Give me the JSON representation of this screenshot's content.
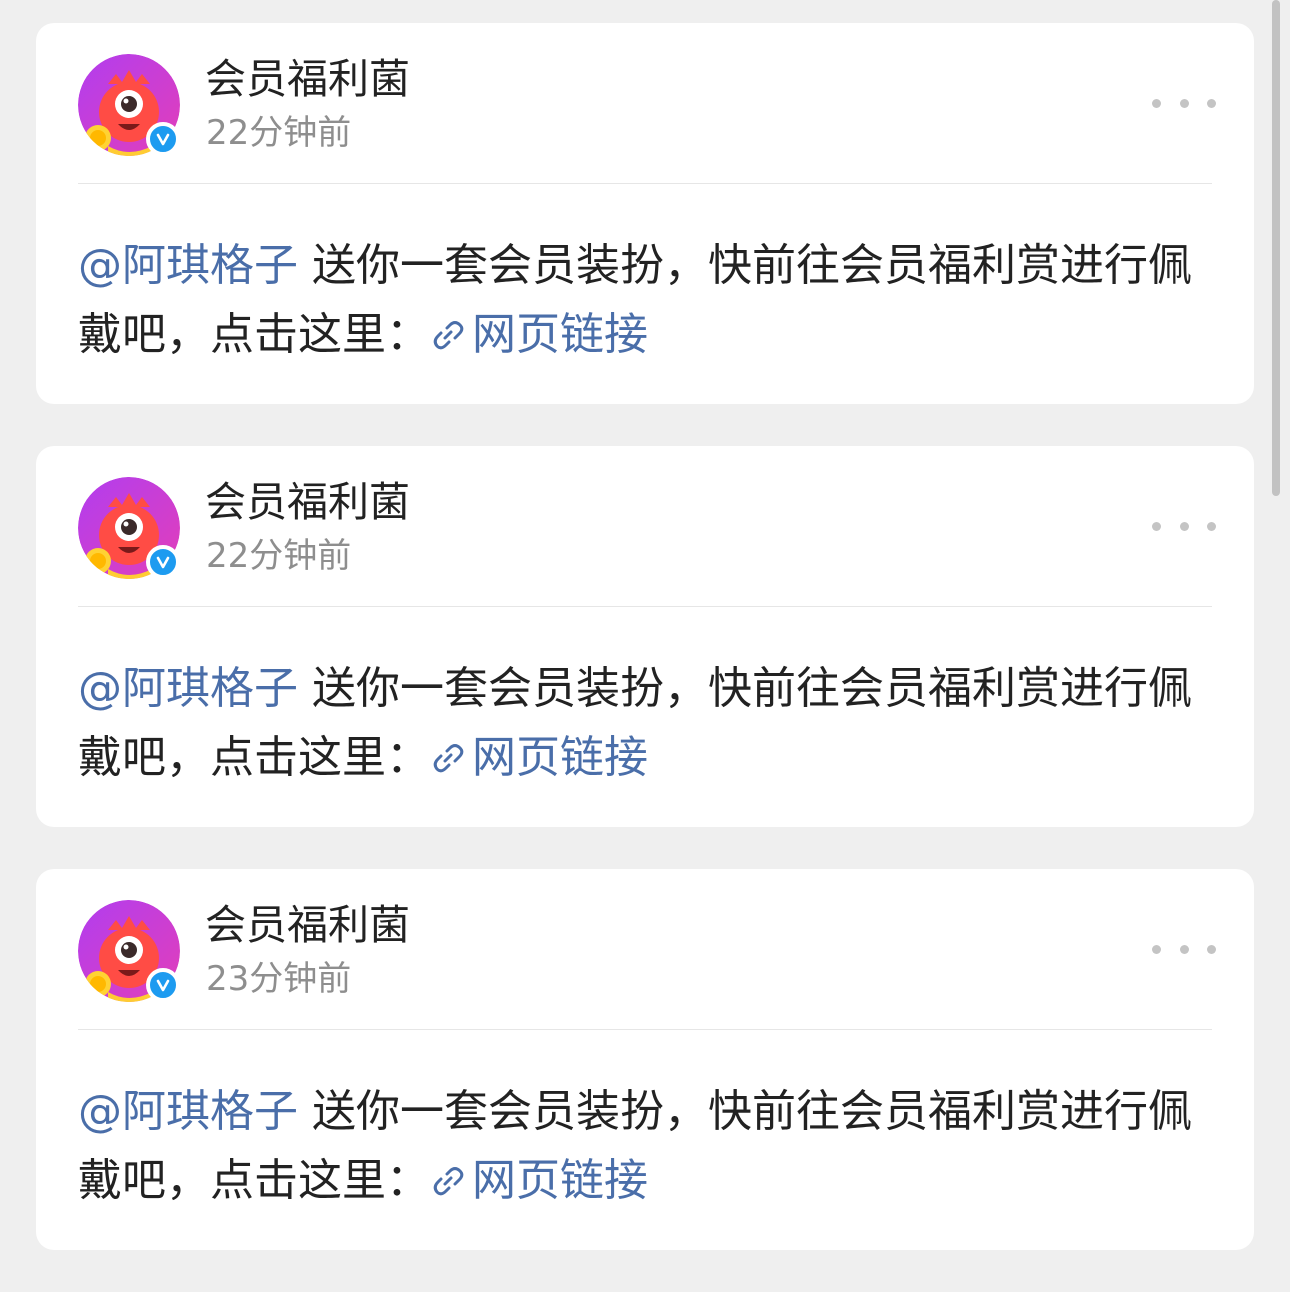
{
  "posts": [
    {
      "user": "会员福利菌",
      "time": "22分钟前",
      "mention": "@阿琪格子",
      "message": " 送你一套会员装扮，快前往会员福利赏进行佩戴吧，点击这里：",
      "link_label": "网页链接"
    },
    {
      "user": "会员福利菌",
      "time": "22分钟前",
      "mention": "@阿琪格子",
      "message": " 送你一套会员装扮，快前往会员福利赏进行佩戴吧，点击这里：",
      "link_label": "网页链接"
    },
    {
      "user": "会员福利菌",
      "time": "23分钟前",
      "mention": "@阿琪格子",
      "message": " 送你一套会员装扮，快前往会员福利赏进行佩戴吧，点击这里：",
      "link_label": "网页链接"
    }
  ],
  "icons": {
    "avatar": "monster-mascot-avatar",
    "verified": "verified-badge-icon",
    "more": "more-dots-icon",
    "link": "link-chain-icon"
  },
  "colors": {
    "link": "#4a6ea9",
    "verified": "#1d9bf0",
    "background": "#efefef",
    "card": "#ffffff"
  }
}
